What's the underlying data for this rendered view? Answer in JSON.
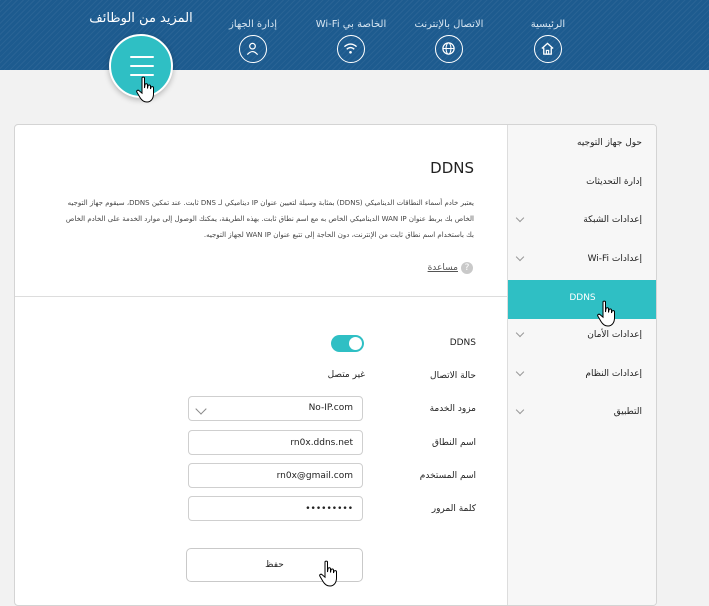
{
  "nav": {
    "items": [
      {
        "label": "الرئيسية",
        "icon": "home-icon"
      },
      {
        "label": "الاتصال بالإنترنت",
        "icon": "globe-icon"
      },
      {
        "label": "Wi-Fi الخاصة بي",
        "icon": "wifi-icon"
      },
      {
        "label": "إدارة الجهاز",
        "icon": "user-icon"
      }
    ],
    "more_title": "المزيد من الوظائف"
  },
  "content": {
    "title": "DDNS",
    "description": "يعتبر خادم أسماء النطاقات الديناميكي (DDNS) بمثابة وسيلة لتعيين عنوان IP ديناميكي لـ DNS ثابت. عند تمكين DDNS، سيقوم جهاز التوجيه الخاص بك بربط عنوان WAN IP الديناميكي الخاص به مع اسم نطاق ثابت. بهذه الطريقة، يمكنك الوصول إلى موارد الخدمة على الخادم الخاص بك باستخدام اسم نطاق ثابت من الإنترنت، دون الحاجة إلى تتبع عنوان WAN IP لجهاز التوجيه.",
    "help_label": "مساعدة"
  },
  "form": {
    "ddns_label": "DDNS",
    "ddns_enabled": true,
    "status_label": "حالة الاتصال",
    "status_value": "غير متصل",
    "provider_label": "مزود الخدمة",
    "provider_value": "No-IP.com",
    "domain_label": "اسم النطاق",
    "domain_value": "rn0x.ddns.net",
    "username_label": "اسم المستخدم",
    "username_value": "rn0x@gmail.com",
    "password_label": "كلمة المرور",
    "password_value": "•••••••••",
    "save_label": "حفظ"
  },
  "sidebar": {
    "items": [
      {
        "label": "حول جهاز التوجيه",
        "expandable": false
      },
      {
        "label": "إدارة التحديثات",
        "expandable": false
      },
      {
        "label": "إعدادات الشبكة",
        "expandable": true
      },
      {
        "label": "إعدادات Wi-Fi",
        "expandable": true
      },
      {
        "label": "DDNS",
        "expandable": false,
        "active": true
      },
      {
        "label": "إعدادات الأمان",
        "expandable": true
      },
      {
        "label": "إعدادات النظام",
        "expandable": true
      },
      {
        "label": "التطبيق",
        "expandable": true
      }
    ]
  },
  "colors": {
    "header_bg": "#1d5b8f",
    "accent": "#2fbfc4"
  }
}
